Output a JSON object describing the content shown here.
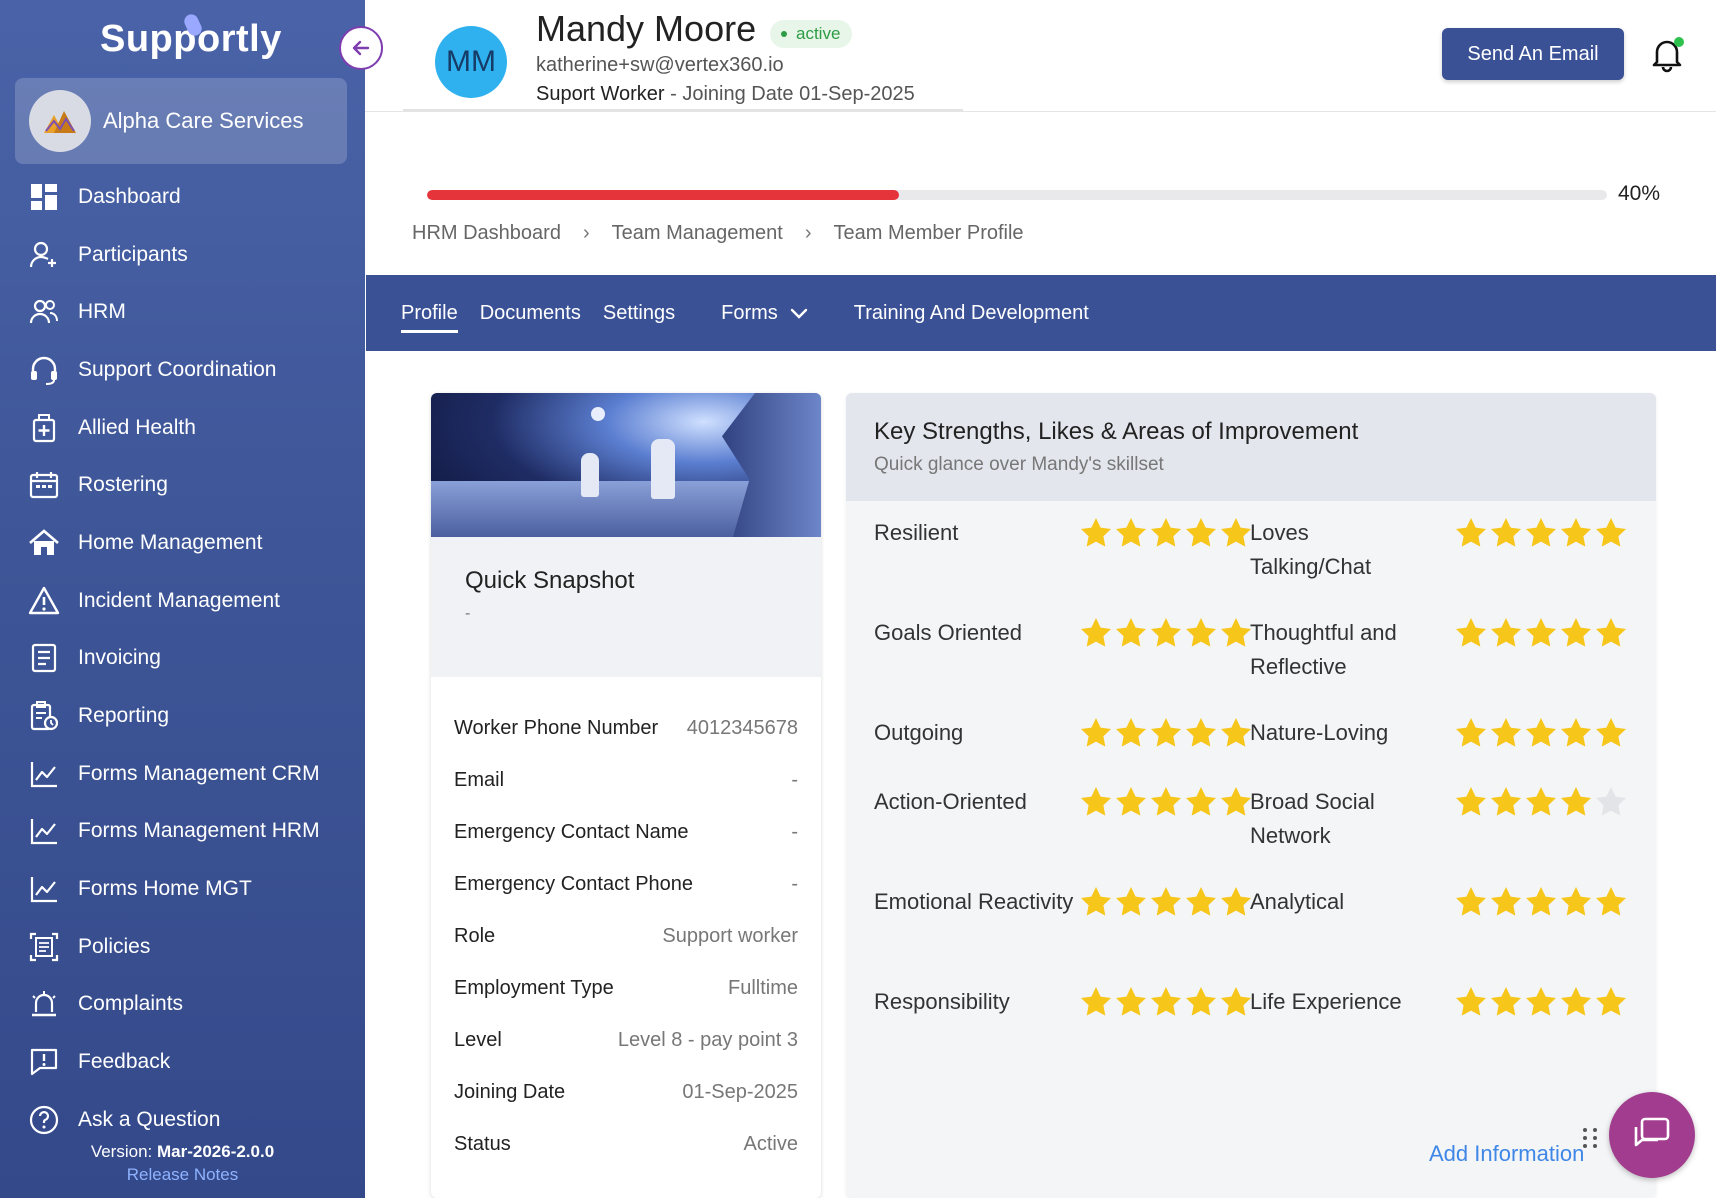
{
  "sidebar": {
    "logo": "Supportly",
    "org_name": "Alpha Care Services",
    "items": [
      {
        "label": "Dashboard",
        "icon": "dashboard-icon"
      },
      {
        "label": "Participants",
        "icon": "participants-icon"
      },
      {
        "label": "HRM",
        "icon": "hrm-icon"
      },
      {
        "label": "Support Coordination",
        "icon": "headset-icon"
      },
      {
        "label": "Allied Health",
        "icon": "medical-icon"
      },
      {
        "label": "Rostering",
        "icon": "calendar-icon"
      },
      {
        "label": "Home Management",
        "icon": "home-icon"
      },
      {
        "label": "Incident Management",
        "icon": "warning-icon"
      },
      {
        "label": "Invoicing",
        "icon": "invoice-icon"
      },
      {
        "label": "Reporting",
        "icon": "report-icon"
      },
      {
        "label": "Forms Management CRM",
        "icon": "chart-icon"
      },
      {
        "label": "Forms Management HRM",
        "icon": "chart-icon"
      },
      {
        "label": "Forms Home MGT",
        "icon": "chart-icon"
      },
      {
        "label": "Policies",
        "icon": "policy-icon"
      },
      {
        "label": "Complaints",
        "icon": "complaint-icon"
      },
      {
        "label": "Feedback",
        "icon": "feedback-icon"
      },
      {
        "label": "Ask a Question",
        "icon": "question-icon"
      }
    ],
    "version_label": "Version: ",
    "version": "Mar-2026-2.0.0",
    "release_notes": "Release Notes"
  },
  "header": {
    "initials": "MM",
    "name": "Mandy Moore",
    "status": "active",
    "email": "katherine+sw@vertex360.io",
    "role": "Suport Worker",
    "joining": " - Joining Date 01-Sep-2025",
    "send_email": "Send An Email"
  },
  "progress": {
    "value": 40,
    "label": "40%"
  },
  "breadcrumbs": [
    "HRM Dashboard",
    "Team Management",
    "Team Member Profile"
  ],
  "tabs": [
    "Profile",
    "Documents",
    "Settings",
    "Forms",
    "Training And Development"
  ],
  "snapshot": {
    "title": "Quick Snapshot",
    "subtitle": "-",
    "rows": [
      {
        "label": "Worker Phone Number",
        "value": "4012345678"
      },
      {
        "label": "Email",
        "value": "-"
      },
      {
        "label": "Emergency Contact Name",
        "value": "-"
      },
      {
        "label": "Emergency Contact Phone",
        "value": "-"
      },
      {
        "label": "Role",
        "value": "Support worker"
      },
      {
        "label": "Employment Type",
        "value": "Fulltime"
      },
      {
        "label": "Level",
        "value": "Level 8 - pay point 3"
      },
      {
        "label": "Joining Date",
        "value": "01-Sep-2025"
      },
      {
        "label": "Status",
        "value": "Active"
      }
    ]
  },
  "strengths": {
    "title": "Key Strengths, Likes & Areas of Improvement",
    "subtitle": "Quick glance over Mandy's skillset",
    "rows": [
      {
        "left": "Resilient",
        "left_stars": 5,
        "right": "Loves Talking/Chat",
        "right_stars": 5
      },
      {
        "left": "Goals Oriented",
        "left_stars": 5,
        "right": "Thoughtful and Reflective",
        "right_stars": 5
      },
      {
        "left": "Outgoing",
        "left_stars": 5,
        "right": "Nature-Loving",
        "right_stars": 5
      },
      {
        "left": "Action-Oriented",
        "left_stars": 5,
        "right": "Broad Social Network",
        "right_stars": 4
      },
      {
        "left": "Emotional Reactivity",
        "left_stars": 5,
        "right": "Analytical",
        "right_stars": 5
      },
      {
        "left": "Responsibility",
        "left_stars": 5,
        "right": "Life Experience",
        "right_stars": 5
      }
    ],
    "add_info": "Add Information"
  },
  "colors": {
    "primary": "#3a5196",
    "accent": "#e5343a",
    "star": "#f7c61b",
    "chat": "#a23c8e"
  }
}
